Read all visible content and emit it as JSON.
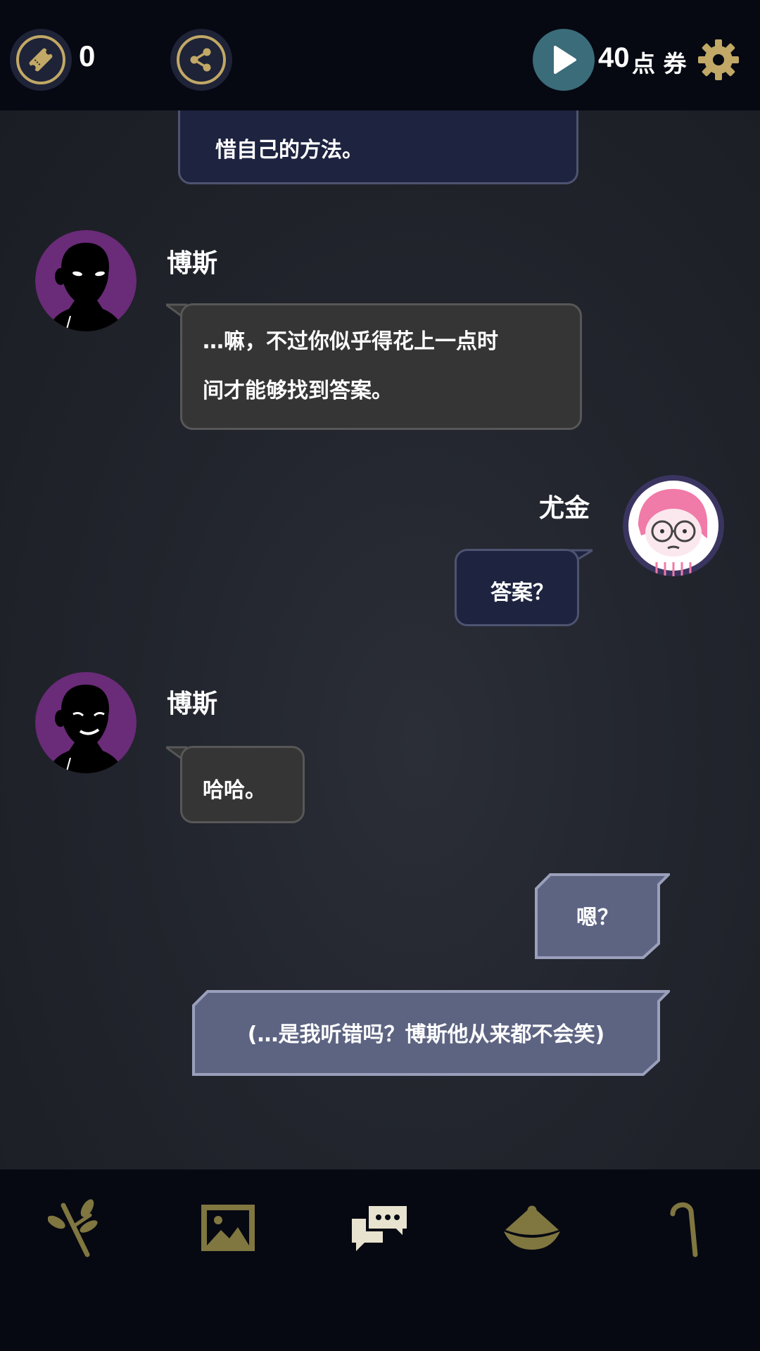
{
  "topbar": {
    "ticket_count": "0",
    "points_value": "40",
    "points_label": "点 券"
  },
  "messages": [
    {
      "speaker": "",
      "text": "惜自己的方法。"
    },
    {
      "speaker": "博斯",
      "line1": "…嘛，不过你似乎得花上一点时",
      "line2": "间才能够找到答案。"
    },
    {
      "speaker": "尤金",
      "text": "答案？"
    },
    {
      "speaker": "博斯",
      "text": "哈哈。"
    }
  ],
  "choices": [
    {
      "text": "嗯？"
    },
    {
      "text": "(…是我听错吗？博斯他从来都不会笑)"
    }
  ],
  "nav": {
    "items": [
      "branch-icon",
      "gallery-icon",
      "chat-icon",
      "hat-icon",
      "cane-icon"
    ],
    "accent": "#807640",
    "active": "#e8e3cf"
  },
  "colors": {
    "gold": "#c2a866",
    "bubble_dark": "#353535",
    "bubble_navy": "#1e2340",
    "choice": "#5d6482"
  }
}
